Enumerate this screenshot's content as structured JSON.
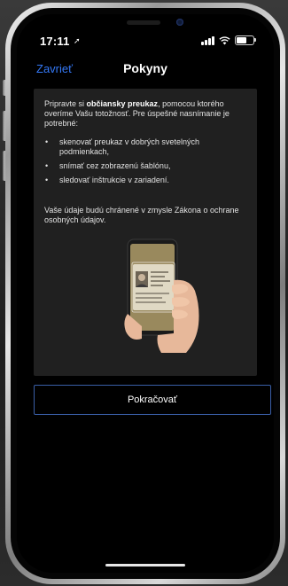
{
  "status_bar": {
    "time": "17:11",
    "location_icon": "location-arrow-icon",
    "signal_icon": "cellular-signal-icon",
    "wifi_icon": "wifi-icon",
    "battery_icon": "battery-icon"
  },
  "nav": {
    "close_label": "Zavrieť",
    "title": "Pokyny",
    "accent": "#3478f6"
  },
  "content": {
    "intro_prefix": "Pripravte si ",
    "intro_bold": "občiansky preukaz",
    "intro_suffix": ", pomocou ktorého overíme Vašu totožnosť. Pre úspešné nasnímanie je potrebné:",
    "bullets": [
      "skenovať preukaz v dobrých svetelných podmienkach,",
      "snímať cez zobrazenú šablónu,",
      "sledovať inštrukcie v zariadení."
    ],
    "outro": "Vaše údaje budú chránené v zmysle Zákona o ochrane osobných údajov."
  },
  "illustration": {
    "icon": "hand-holding-phone-with-id-card-icon"
  },
  "actions": {
    "continue_label": "Pokračovať",
    "border_color": "#3a5fa8"
  }
}
